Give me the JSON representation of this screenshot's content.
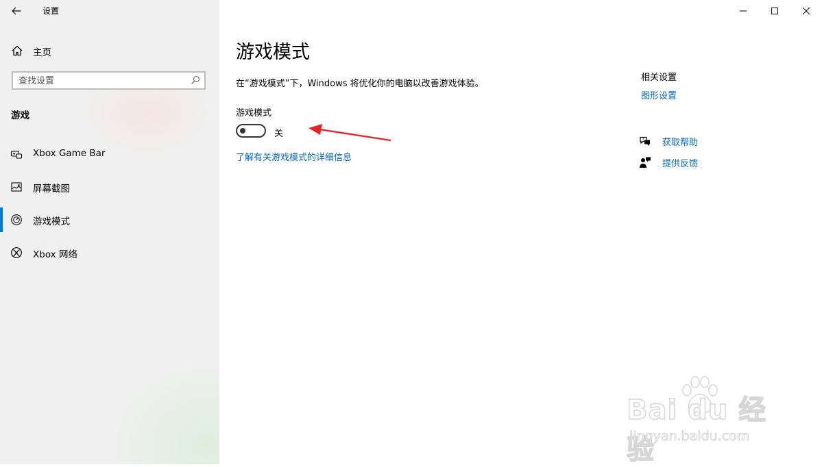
{
  "window": {
    "title": "设置"
  },
  "sidebar": {
    "home_label": "主页",
    "search_placeholder": "查找设置",
    "section_header": "游戏",
    "items": [
      {
        "label": "Xbox Game Bar",
        "icon": "xbox-game-bar-icon",
        "selected": false
      },
      {
        "label": "屏幕截图",
        "icon": "capture-icon",
        "selected": false
      },
      {
        "label": "游戏模式",
        "icon": "game-mode-icon",
        "selected": true
      },
      {
        "label": "Xbox 网络",
        "icon": "xbox-icon",
        "selected": false
      }
    ]
  },
  "main": {
    "title": "游戏模式",
    "description": "在“游戏模式”下，Windows 将优化你的电脑以改善游戏体验。",
    "setting_label": "游戏模式",
    "toggle_state": "关",
    "toggle_on": false,
    "learn_more": "了解有关游戏模式的详细信息"
  },
  "related": {
    "title": "相关设置",
    "graphics_link": "图形设置",
    "get_help": "获取帮助",
    "feedback": "提供反馈"
  },
  "annotation": {
    "arrow_color": "#e3242b"
  },
  "watermark": {
    "brand": "Bai du 经验",
    "url": "jingyan.baidu.com"
  },
  "colors": {
    "accent": "#0078d7",
    "link": "#0067c0",
    "sidebar_bg": "#f0f0f0"
  }
}
